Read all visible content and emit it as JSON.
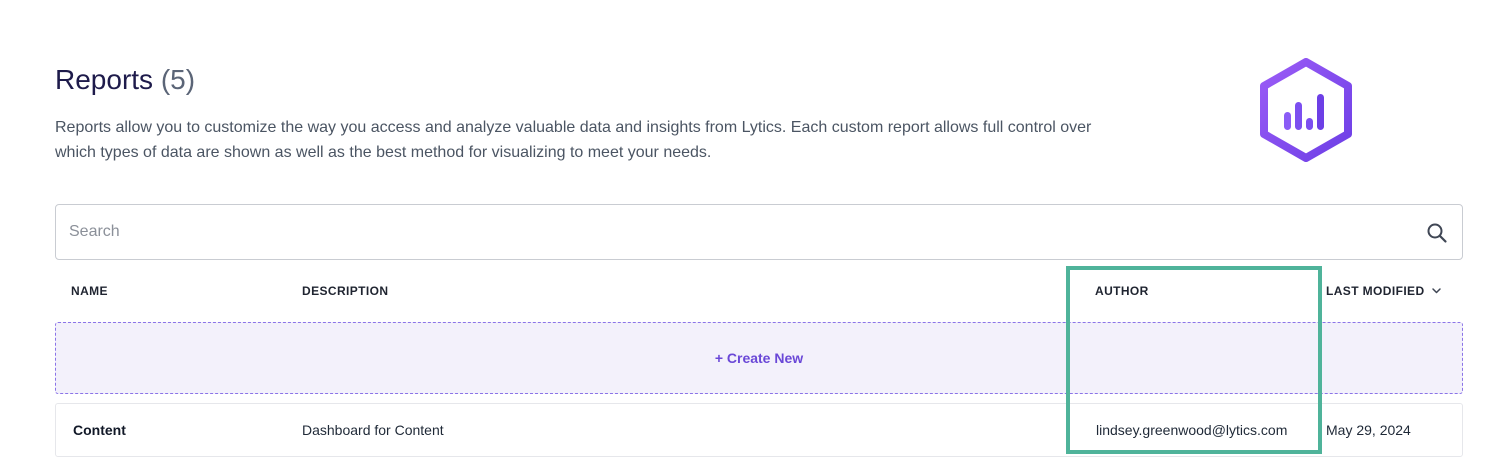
{
  "header": {
    "title": "Reports",
    "count": "(5)",
    "description": "Reports allow you to customize the way you access and analyze valuable data and insights from Lytics. Each custom report allows full control over which types of data are shown as well as the best method for visualizing to meet your needs.",
    "logo_icon": "report-bar-chart-hexagon-icon"
  },
  "search": {
    "placeholder": "Search",
    "value": "",
    "icon": "search-icon"
  },
  "table": {
    "columns": {
      "name": "NAME",
      "description": "DESCRIPTION",
      "author": "AUTHOR",
      "last_modified": "LAST MODIFIED"
    },
    "sort_column": "last_modified",
    "sort_direction": "descending",
    "create_label": "+ Create New",
    "rows": [
      {
        "name": "Content",
        "description": "Dashboard for Content",
        "author": "lindsey.greenwood@lytics.com",
        "last_modified": "May 29, 2024"
      }
    ]
  },
  "colors": {
    "accent": "#6a48d7",
    "highlight": "#4fb39a",
    "title": "#1e1b4b"
  }
}
